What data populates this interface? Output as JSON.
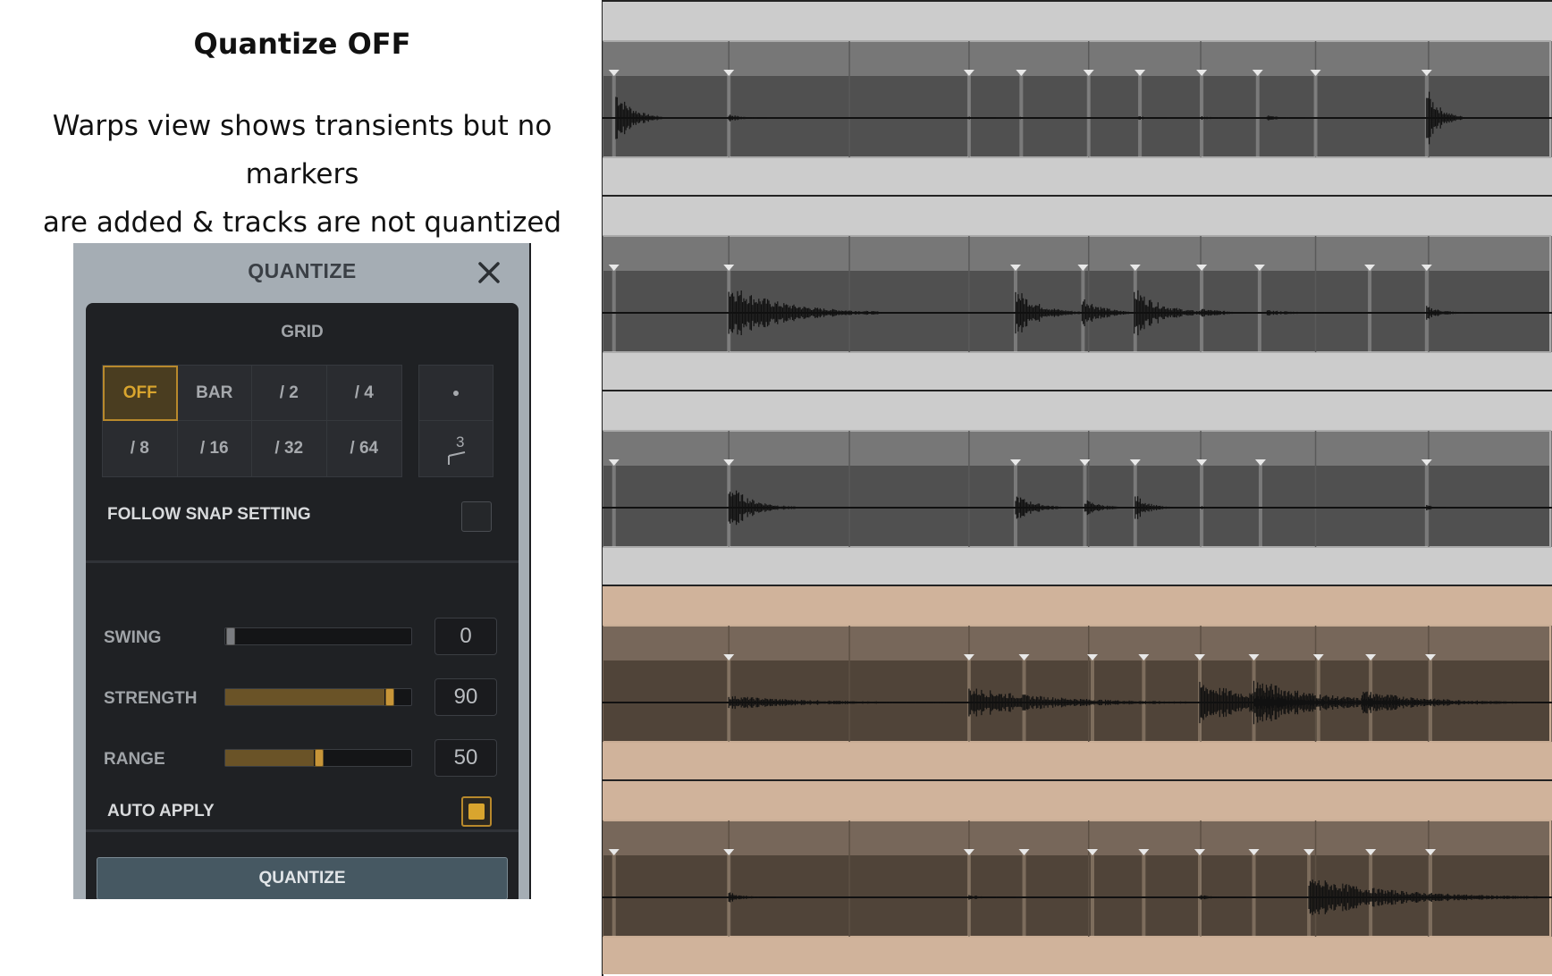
{
  "caption": {
    "title": "Quantize OFF",
    "line1": "Warps view shows transients but no markers",
    "line2": "are added & tracks are not quantized"
  },
  "quantize_panel": {
    "title": "QUANTIZE",
    "grid_label": "GRID",
    "grid_buttons": [
      "OFF",
      "BAR",
      "/ 2",
      "/ 4",
      "/ 8",
      "/ 16",
      "/ 32",
      "/ 64"
    ],
    "selected_grid": "OFF",
    "modifiers": {
      "dotted_icon": "dot-icon",
      "triplet_label": "3"
    },
    "follow_snap": {
      "label": "FOLLOW SNAP SETTING",
      "checked": false
    },
    "sliders": [
      {
        "label": "SWING",
        "value": "0",
        "fraction": 0.0
      },
      {
        "label": "STRENGTH",
        "value": "90",
        "fraction": 0.9
      },
      {
        "label": "RANGE",
        "value": "50",
        "fraction": 0.5
      }
    ],
    "auto_apply": {
      "label": "AUTO APPLY",
      "checked": true
    },
    "quantize_button": "QUANTIZE"
  },
  "colors": {
    "accent": "#d9a52e",
    "grey_track_bg": "#cccccc",
    "grey_clip": "#505050",
    "tan_track_bg": "#d0b39b",
    "tan_clip": "#504439"
  },
  "tracks": [
    {
      "color": "grey",
      "transients": [
        0.012,
        0.133,
        0.386,
        0.441,
        0.512,
        0.566,
        0.631,
        0.69,
        0.751,
        0.868
      ],
      "hits": [
        [
          0.014,
          0.85,
          0.05
        ],
        [
          0.133,
          0.12,
          0.04
        ],
        [
          0.385,
          0.05,
          0.03
        ],
        [
          0.44,
          0.04,
          0.02
        ],
        [
          0.565,
          0.06,
          0.03
        ],
        [
          0.63,
          0.07,
          0.04
        ],
        [
          0.7,
          0.08,
          0.04
        ],
        [
          0.868,
          0.9,
          0.04
        ]
      ]
    },
    {
      "color": "grey",
      "transients": [
        0.012,
        0.133,
        0.435,
        0.506,
        0.561,
        0.631,
        0.692,
        0.808,
        0.868
      ],
      "hits": [
        [
          0.133,
          0.85,
          0.16
        ],
        [
          0.435,
          0.75,
          0.07
        ],
        [
          0.505,
          0.5,
          0.06
        ],
        [
          0.56,
          0.75,
          0.08
        ],
        [
          0.63,
          0.12,
          0.1
        ],
        [
          0.7,
          0.08,
          0.1
        ],
        [
          0.868,
          0.2,
          0.05
        ]
      ]
    },
    {
      "color": "grey",
      "transients": [
        0.012,
        0.133,
        0.435,
        0.508,
        0.561,
        0.631,
        0.693,
        0.868
      ],
      "hits": [
        [
          0.133,
          0.7,
          0.07
        ],
        [
          0.435,
          0.4,
          0.06
        ],
        [
          0.508,
          0.25,
          0.05
        ],
        [
          0.561,
          0.4,
          0.04
        ],
        [
          0.63,
          0.05,
          0.03
        ],
        [
          0.868,
          0.1,
          0.02
        ]
      ]
    },
    {
      "color": "tan",
      "transients": [
        0.133,
        0.386,
        0.444,
        0.516,
        0.57,
        0.629,
        0.686,
        0.754,
        0.809,
        0.872
      ],
      "hits": [
        [
          0.133,
          0.2,
          0.25
        ],
        [
          0.386,
          0.45,
          0.25
        ],
        [
          0.629,
          0.6,
          0.2
        ],
        [
          0.686,
          0.7,
          0.2
        ],
        [
          0.8,
          0.35,
          0.2
        ]
      ]
    },
    {
      "color": "tan",
      "transients": [
        0.012,
        0.133,
        0.386,
        0.444,
        0.516,
        0.57,
        0.629,
        0.686,
        0.744,
        0.809,
        0.872
      ],
      "hits": [
        [
          0.133,
          0.15,
          0.05
        ],
        [
          0.386,
          0.08,
          0.05
        ],
        [
          0.629,
          0.08,
          0.05
        ],
        [
          0.744,
          0.6,
          0.25
        ]
      ]
    }
  ]
}
